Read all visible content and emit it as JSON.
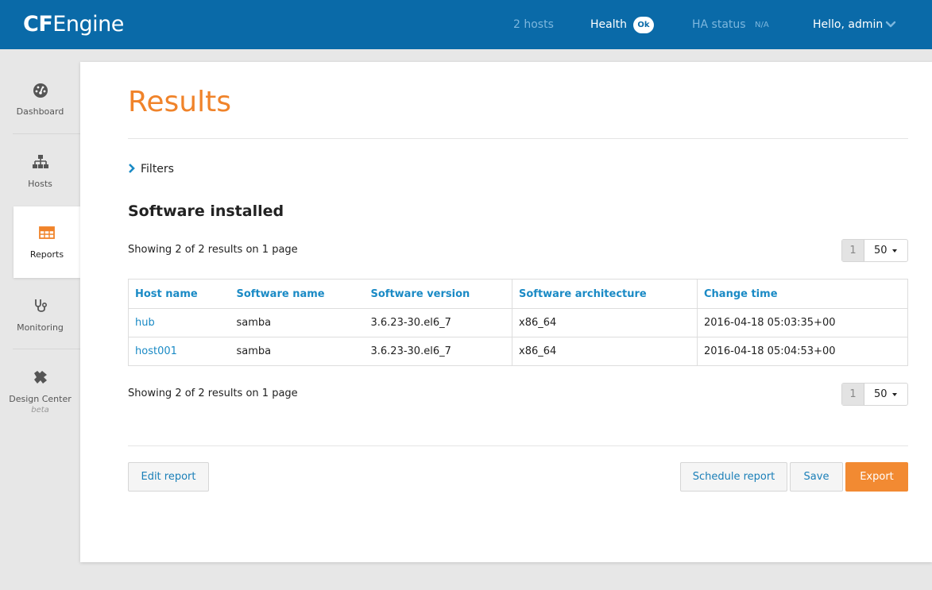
{
  "header": {
    "logo_bold": "CF",
    "logo_light": "Engine",
    "hosts": "2 hosts",
    "health_label": "Health",
    "health_badge": "Ok",
    "ha_status_label": "HA status",
    "ha_status_value": "N/A",
    "user_greeting": "Hello, admin"
  },
  "sidebar": {
    "items": [
      {
        "label": "Dashboard",
        "icon": "dashboard-gauge-icon"
      },
      {
        "label": "Hosts",
        "icon": "sitemap-icon"
      },
      {
        "label": "Reports",
        "icon": "table-icon",
        "active": true
      },
      {
        "label": "Monitoring",
        "icon": "stethoscope-icon"
      },
      {
        "label": "Design Center",
        "sublabel": "beta",
        "icon": "puzzle-icon"
      }
    ]
  },
  "main": {
    "title": "Results",
    "filters_label": "Filters",
    "section_title": "Software installed",
    "showing_text": "Showing 2 of 2 results on 1 page",
    "pager": {
      "page": "1",
      "per_page": "50"
    },
    "table": {
      "headers": [
        "Host name",
        "Software name",
        "Software version",
        "Software architecture",
        "Change time"
      ],
      "rows": [
        [
          "hub",
          "samba",
          "3.6.23-30.el6_7",
          "x86_64",
          "2016-04-18 05:03:35+00"
        ],
        [
          "host001",
          "samba",
          "3.6.23-30.el6_7",
          "x86_64",
          "2016-04-18 05:04:53+00"
        ]
      ]
    },
    "buttons": {
      "edit": "Edit report",
      "schedule": "Schedule report",
      "save": "Save",
      "export": "Export"
    }
  },
  "colors": {
    "topbar": "#0a6aa8",
    "accent_orange": "#f0832a",
    "link_blue": "#1a8ac5"
  }
}
